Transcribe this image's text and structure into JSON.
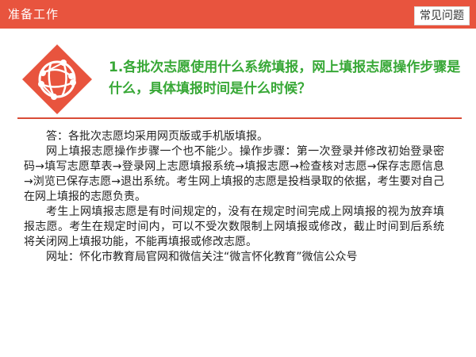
{
  "header": {
    "title": "准备工作",
    "tag": "常见问题"
  },
  "logo": {
    "icon": "globe-network-icon",
    "color": "#e8543e"
  },
  "question": "1.各批次志愿使用什么系统填报，网上填报志愿操作步骤是什么，具体填报时间是什么时候？",
  "answer": [
    "答：各批次志愿均采用网页版或手机版填报。",
    "网上填报志愿操作步骤一个也不能少。操作步骤：第一次登录并修改初始登录密码→填写志愿草表→登录网上志愿填报系统→填报志愿→检查核对志愿→保存志愿信息→浏览已保存志愿→退出系统。考生网上填报的志愿是投档录取的依据，考生要对自己在网上填报的志愿负责。",
    "考生上网填报志愿是有时间规定的，没有在规定时间完成上网填报的视为放弃填报志愿。考生在规定时间内，可以不受次数限制上网填报或修改，截止时间到后系统将关闭网上填报功能，不能再填报或修改志愿。",
    "网址：怀化市教育局官网和微信关注“微言怀化教育”微信公众号"
  ],
  "colors": {
    "accent": "#e8543e",
    "question": "#38a837"
  }
}
